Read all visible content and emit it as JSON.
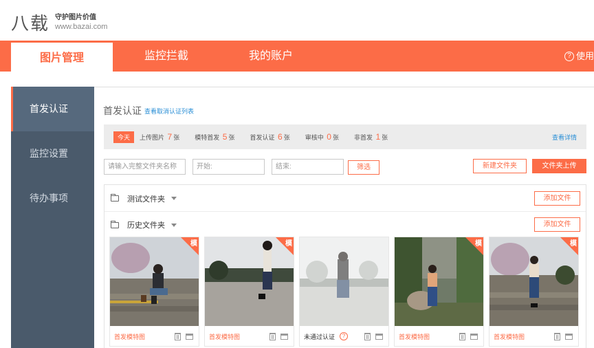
{
  "logo": {
    "mark": "八载",
    "slogan": "守护图片价值",
    "url": "www.bazai.com"
  },
  "nav": {
    "tabs": [
      {
        "label": "图片管理"
      },
      {
        "label": "监控拦截"
      },
      {
        "label": "我的账户"
      }
    ],
    "help": "使用"
  },
  "sidebar": {
    "items": [
      {
        "label": "首发认证"
      },
      {
        "label": "监控设置"
      },
      {
        "label": "待办事项"
      }
    ]
  },
  "main": {
    "title": "首发认证",
    "link": "查看取消认证列表",
    "stats": {
      "today": "今天",
      "items": [
        {
          "label": "上传图片",
          "value": "7",
          "unit": "张"
        },
        {
          "label": "模特首发",
          "value": "5",
          "unit": "张"
        },
        {
          "label": "首发认证",
          "value": "6",
          "unit": "张"
        },
        {
          "label": "审核中",
          "value": "0",
          "unit": "张"
        },
        {
          "label": "非首发",
          "value": "1",
          "unit": "张"
        }
      ],
      "detail": "查看详情"
    },
    "filters": {
      "folder_placeholder": "请输入完整文件夹名称",
      "start_placeholder": "开始:",
      "end_placeholder": "结束:",
      "filter_button": "筛选"
    },
    "new_folder": "新建文件夹",
    "upload": "文件夹上传",
    "folders": [
      {
        "name": "测试文件夹",
        "add": "添加文件"
      },
      {
        "name": "历史文件夹",
        "add": "添加文件"
      }
    ],
    "badge": "模",
    "cards": [
      {
        "status": "首发模特图",
        "model": true
      },
      {
        "status": "首发模特图",
        "model": true
      },
      {
        "status": "未通过认证",
        "model": false
      },
      {
        "status": "首发模特图",
        "model": true
      },
      {
        "status": "首发模特图",
        "model": true
      }
    ]
  }
}
